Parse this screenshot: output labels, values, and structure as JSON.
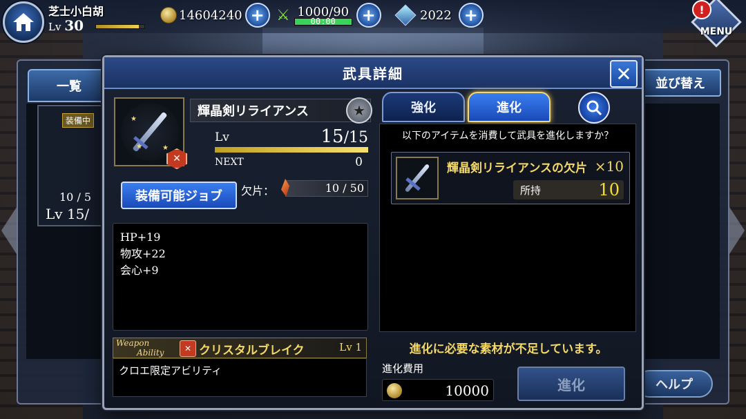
{
  "player": {
    "name": "芝士小白胡",
    "lv_label": "Lv",
    "lv_value": "30",
    "xp_fraction": 0.88
  },
  "resources": {
    "gil": "14604240",
    "stamina_value": "1000/90",
    "stamina_timer": "00:00",
    "stamina_fraction": 1.0,
    "gems": "2022"
  },
  "menu_label": "MENU",
  "background": {
    "tab_list": "一覧",
    "sort_label": "並び替え",
    "help_label": "ヘルプ",
    "equipped_badge": "装備中",
    "card_count": "10 / 5",
    "card_lv": "Lv 15/"
  },
  "modal": {
    "title": "武具詳細",
    "weapon": {
      "name": "輝晶剣リライアンス",
      "lv_label": "Lv",
      "lv_current": "15",
      "lv_max": "/15",
      "lv_fraction": 1.0,
      "next_label": "NEXT",
      "next_value": "0",
      "shard_label": "欠片：",
      "shard_value": "10 / 50",
      "stars": "★★"
    },
    "job_button": "装備可能ジョブ",
    "stats": [
      "HP+19",
      "物攻+22",
      "会心+9"
    ],
    "ability": {
      "tag_line1": "Weapon",
      "tag_line2": "Ability",
      "name": "クリスタルブレイク",
      "lv": "Lv 1",
      "desc": "クロエ限定アビリティ"
    },
    "tabs": {
      "enhance": "強化",
      "evolve": "進化"
    },
    "evolve_prompt": "以下のアイテムを消費して武具を進化しますか？",
    "material": {
      "name": "輝晶剣リライアンスの欠片",
      "qty": "×10",
      "owned_label": "所持",
      "owned_value": "10"
    },
    "warning": "進化に必要な素材が不足しています。",
    "cost_label": "進化費用",
    "cost_value": "10000",
    "evolve_button": "進化"
  }
}
